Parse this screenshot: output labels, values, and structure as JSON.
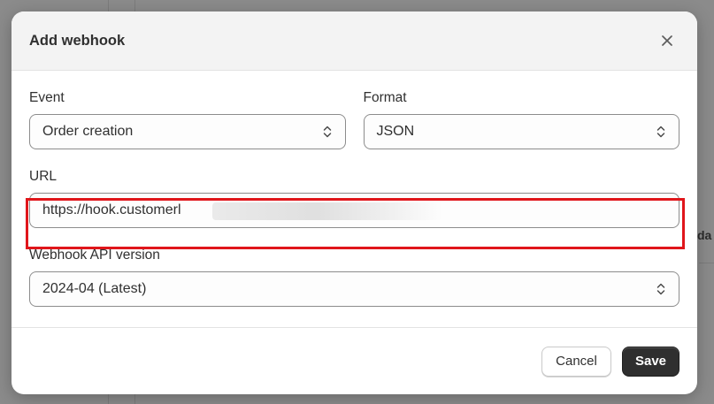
{
  "background": {
    "peek_text": "da"
  },
  "modal": {
    "title": "Add webhook",
    "close_icon": "close-icon",
    "event": {
      "label": "Event",
      "value": "Order creation"
    },
    "format": {
      "label": "Format",
      "value": "JSON"
    },
    "url": {
      "label": "URL",
      "value": "https://hook.customerl"
    },
    "api_version": {
      "label": "Webhook API version",
      "value": "2024-04 (Latest)"
    },
    "buttons": {
      "cancel": "Cancel",
      "save": "Save"
    }
  },
  "colors": {
    "highlight": "#e0161b",
    "primary_button": "#2f2f2f",
    "header_bg": "#f3f3f3"
  }
}
